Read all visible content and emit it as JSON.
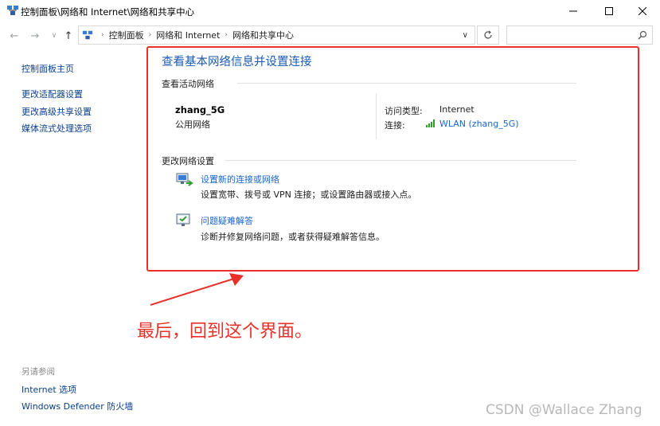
{
  "window": {
    "title": "控制面板\\网络和 Internet\\网络和共享中心"
  },
  "address": {
    "crumbs": [
      "控制面板",
      "网络和 Internet",
      "网络和共享中心"
    ]
  },
  "left_panel": {
    "links": [
      "控制面板主页",
      "更改适配器设置",
      "更改高级共享设置",
      "媒体流式处理选项"
    ],
    "see_also_heading": "另请参阅",
    "see_also": [
      "Internet 选项",
      "Windows Defender 防火墙"
    ]
  },
  "main": {
    "title": "查看基本网络信息并设置连接",
    "active_heading": "查看活动网络",
    "network_name": "zhang_5G",
    "network_type": "公用网络",
    "access_type_label": "访问类型:",
    "access_type_value": "Internet",
    "connection_label": "连接:",
    "connection_value": "WLAN (zhang_5G)",
    "change_heading": "更改网络设置",
    "tasks": [
      {
        "title": "设置新的连接或网络",
        "desc": "设置宽带、拨号或 VPN 连接；或设置路由器或接入点。",
        "icon": "network-setup-icon"
      },
      {
        "title": "问题疑难解答",
        "desc": "诊断并修复网络问题，或者获得疑难解答信息。",
        "icon": "troubleshoot-icon"
      }
    ]
  },
  "annotation": {
    "text": "最后，回到这个界面。"
  },
  "watermark": "CSDN @Wallace Zhang",
  "colors": {
    "accent": "#1a5bb5",
    "annotation": "#e8312a",
    "signal": "#2e9e2e"
  }
}
